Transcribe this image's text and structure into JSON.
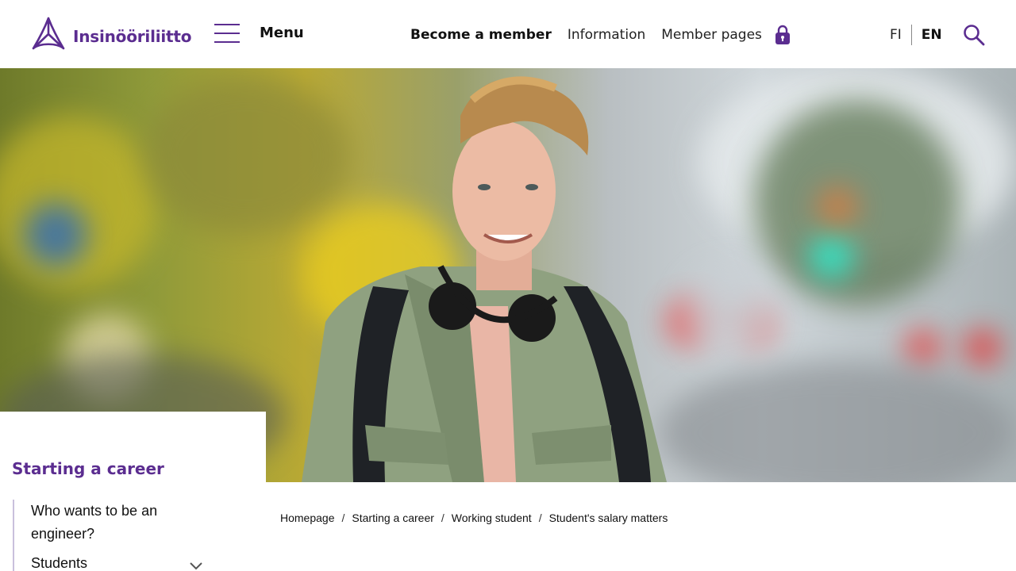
{
  "header": {
    "logo_text": "Insinööriliitto",
    "menu_label": "Menu",
    "nav": [
      {
        "label": "Become a member"
      },
      {
        "label": "Information"
      },
      {
        "label": "Member pages"
      }
    ],
    "lang": {
      "fi": "FI",
      "en": "EN"
    },
    "icons": {
      "menu": "hamburger-icon",
      "lock": "lock-icon",
      "search": "search-icon",
      "logo": "logo-icon"
    }
  },
  "hero": {
    "alt_description": ""
  },
  "sidebar": {
    "title": "Starting a career",
    "items": [
      {
        "label": "Who wants to be an engineer?"
      },
      {
        "label": "Students"
      }
    ]
  },
  "breadcrumb": [
    {
      "label": "Homepage"
    },
    {
      "label": "Starting a career"
    },
    {
      "label": "Working student"
    },
    {
      "label": "Student's salary matters"
    }
  ],
  "colors": {
    "brand": "#5b2d90",
    "text": "#111111",
    "background": "#ffffff"
  }
}
